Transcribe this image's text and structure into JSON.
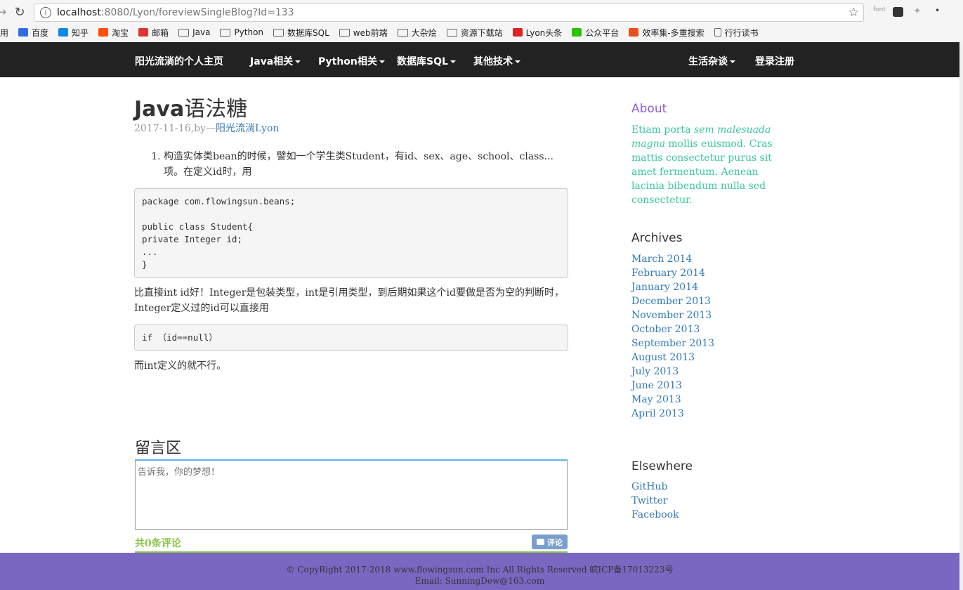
{
  "browser": {
    "url_host": "localhost",
    "url_path": ":8080/Lyon/foreviewSingleBlog?Id=133",
    "ext_font_label": "font",
    "bookmarks": [
      {
        "label": "用",
        "kind": "text",
        "color": ""
      },
      {
        "label": "百度",
        "kind": "icon",
        "color": "#2f6fe2"
      },
      {
        "label": "知乎",
        "kind": "icon",
        "color": "#0f88eb"
      },
      {
        "label": "淘宝",
        "kind": "icon",
        "color": "#ff5000"
      },
      {
        "label": "邮箱",
        "kind": "icon",
        "color": "#d33"
      },
      {
        "label": "Java",
        "kind": "folder",
        "color": ""
      },
      {
        "label": "Python",
        "kind": "folder",
        "color": ""
      },
      {
        "label": "数据库SQL",
        "kind": "folder",
        "color": ""
      },
      {
        "label": "web前端",
        "kind": "folder",
        "color": ""
      },
      {
        "label": "大杂烩",
        "kind": "folder",
        "color": ""
      },
      {
        "label": "资源下载站",
        "kind": "folder",
        "color": ""
      },
      {
        "label": "Lyon头条",
        "kind": "icon",
        "color": "#d22"
      },
      {
        "label": "公众平台",
        "kind": "icon",
        "color": "#2dc100"
      },
      {
        "label": "效率集-多重搜索",
        "kind": "icon",
        "color": "#e8501a"
      },
      {
        "label": "行行读书",
        "kind": "page",
        "color": ""
      }
    ]
  },
  "nav": {
    "brand": "阳光流淌的个人主页",
    "java": "Java相关",
    "python": "Python相关",
    "sql": "数据库SQL",
    "other": "其他技术",
    "life": "生活杂谈",
    "login": "登录注册"
  },
  "post": {
    "title_latin": "Java",
    "title_cjk": "语法糖",
    "date": "2017-11-16,by—",
    "author": "阳光流淌Lyon",
    "list_item": "构造实体类bean的时候，譬如一个学生类Student，有id、sex、age、school、class...项。在定义id时，用",
    "code1": "package com.flowingsun.beans;\n\npublic class Student{\nprivate Integer id;\n...\n}",
    "para1": "比直接int id好！Integer是包装类型，int是引用类型，到后期如果这个id要做是否为空的判断时，Integer定义过的id可以直接用",
    "code2": "if （id==null）",
    "para2": "而int定义的就不行。"
  },
  "comments": {
    "title": "留言区",
    "placeholder": "告诉我，你的梦想！",
    "count": "共0条评论",
    "button": "评论"
  },
  "sidebar": {
    "about_title": "About",
    "about_p1": "Etiam porta ",
    "about_em": "sem malesuada magna",
    "about_p2": " mollis euismod. Cras mattis consectetur purus sit amet fermentum. Aenean lacinia bibendum nulla sed consectetur.",
    "archives_title": "Archives",
    "archives": [
      "March 2014",
      "February 2014",
      "January 2014",
      "December 2013",
      "November 2013",
      "October 2013",
      "September 2013",
      "August 2013",
      "July 2013",
      "June 2013",
      "May 2013",
      "April 2013"
    ],
    "elsewhere_title": "Elsewhere",
    "elsewhere": [
      "GitHub",
      "Twitter",
      "Facebook"
    ]
  },
  "footer": {
    "line1": "© CopyRight 2017-2018 www.flowingsun.com Inc All Rights Reserved 皖ICP备17013223号",
    "line2": "Email: SunningDew@163.com"
  }
}
